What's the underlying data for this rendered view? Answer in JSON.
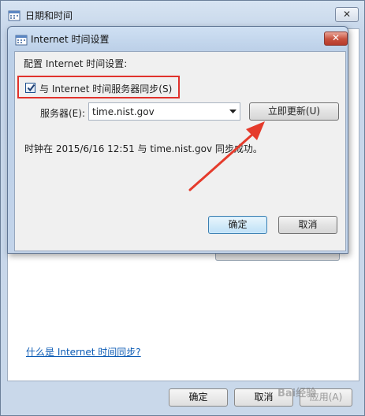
{
  "background_window": {
    "title": "日期和时间",
    "close_label": "✕",
    "help_link": "什么是 Internet 时间同步?",
    "buttons": {
      "ok": "确定",
      "cancel": "取消",
      "apply": "应用(A)"
    }
  },
  "dialog": {
    "title": "Internet 时间设置",
    "close_label": "✕",
    "heading": "配置 Internet 时间设置:",
    "sync_checkbox": {
      "label": "与 Internet 时间服务器同步(S)",
      "checked": true
    },
    "server": {
      "label": "服务器(E):",
      "value": "time.nist.gov"
    },
    "update_button": "立即更新(U)",
    "status": "时钟在 2015/6/16 12:51 与 time.nist.gov 同步成功。",
    "ok_button": "确定",
    "cancel_button": "取消"
  },
  "annotations": {
    "highlight_color": "#e0322c",
    "arrow_color": "#e53b2c"
  },
  "watermark": "Bai经验"
}
